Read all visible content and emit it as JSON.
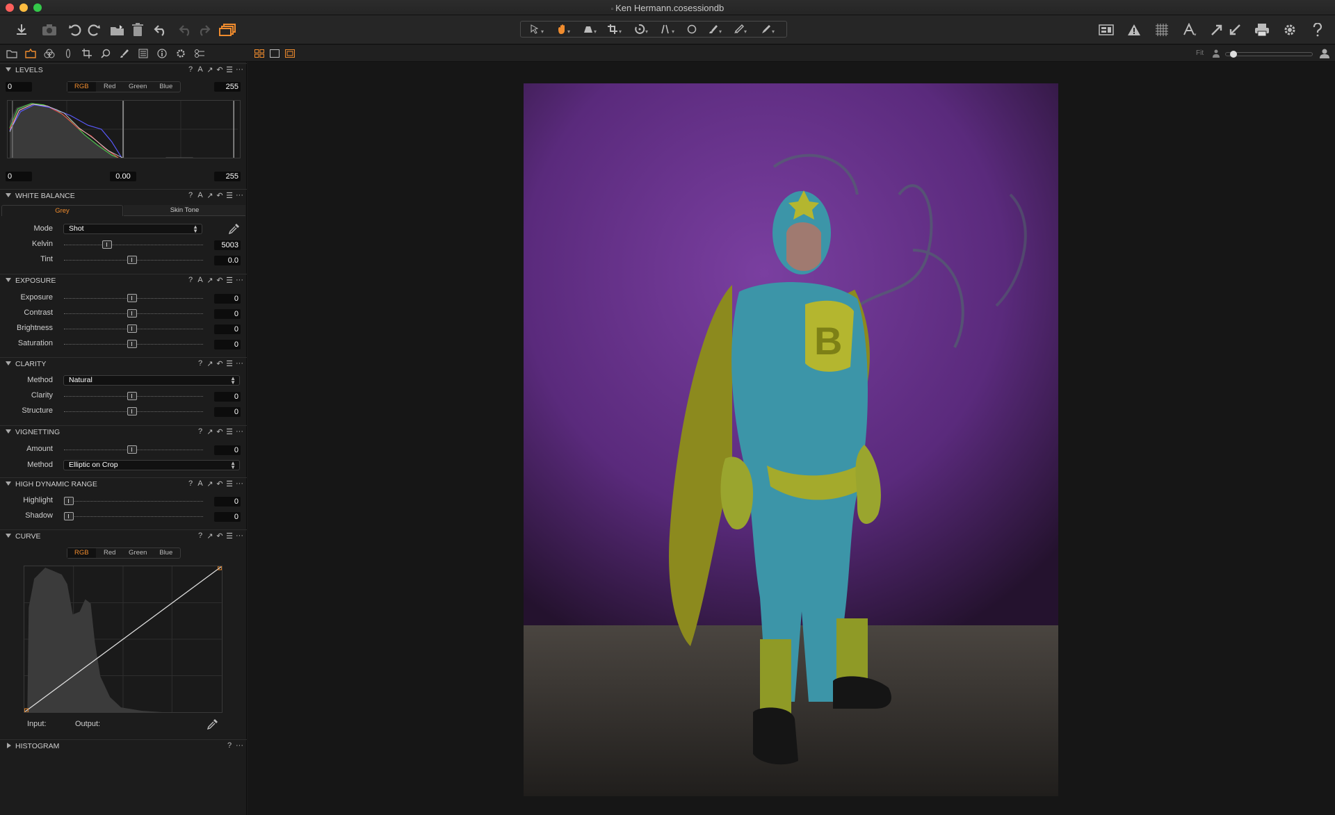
{
  "window": {
    "title": "Ken Hermann.cosessiondb"
  },
  "colors": {
    "accent": "#f08c2e",
    "red_curve": "#e04848",
    "green_curve": "#4ac44a",
    "blue_curve": "#5a5aff"
  },
  "toolbar": {
    "left_icons": [
      "import-icon",
      "camera-icon",
      "rotate-left-icon",
      "rotate-right-icon",
      "move-to-folder-icon",
      "trash-icon",
      "undo-icon",
      "undo-disabled-icon",
      "redo-disabled-icon",
      "copy-apply-icon"
    ],
    "cursor_tools": [
      "select-cursor-icon",
      "pan-hand-icon",
      "loupe-icon",
      "crop-icon",
      "rotate-straighten-icon",
      "keystone-icon",
      "spot-removal-icon",
      "brush-icon",
      "eraser-icon",
      "picker-icon"
    ],
    "right_icons": [
      "layout-icon",
      "exposure-warning-icon",
      "grid-icon",
      "text-overlay-icon",
      "copy-adjustments-icon",
      "apply-adjustments-icon",
      "print-icon",
      "settings-icon",
      "help-icon"
    ]
  },
  "viewer_bar": {
    "fit_label": "Fit"
  },
  "levels": {
    "name": "LEVELS",
    "input_low": "0",
    "input_high": "255",
    "output_low": "0",
    "midtone": "0.00",
    "output_high": "255",
    "channels": [
      "RGB",
      "Red",
      "Green",
      "Blue"
    ],
    "active_channel": "RGB"
  },
  "white_balance": {
    "name": "WHITE BALANCE",
    "tabs": [
      "Grey",
      "Skin Tone"
    ],
    "active_tab": "Grey",
    "mode_label": "Mode",
    "mode_value": "Shot",
    "kelvin_label": "Kelvin",
    "kelvin_value": "5003",
    "tint_label": "Tint",
    "tint_value": "0.0"
  },
  "exposure": {
    "name": "EXPOSURE",
    "rows": [
      {
        "label": "Exposure",
        "value": "0"
      },
      {
        "label": "Contrast",
        "value": "0"
      },
      {
        "label": "Brightness",
        "value": "0"
      },
      {
        "label": "Saturation",
        "value": "0"
      }
    ]
  },
  "clarity": {
    "name": "CLARITY",
    "method_label": "Method",
    "method_value": "Natural",
    "rows": [
      {
        "label": "Clarity",
        "value": "0"
      },
      {
        "label": "Structure",
        "value": "0"
      }
    ]
  },
  "vignetting": {
    "name": "VIGNETTING",
    "amount_label": "Amount",
    "amount_value": "0",
    "method_label": "Method",
    "method_value": "Elliptic on Crop"
  },
  "hdr": {
    "name": "HIGH DYNAMIC RANGE",
    "rows": [
      {
        "label": "Highlight",
        "value": "0"
      },
      {
        "label": "Shadow",
        "value": "0"
      }
    ]
  },
  "curve": {
    "name": "CURVE",
    "channels": [
      "RGB",
      "Red",
      "Green",
      "Blue"
    ],
    "active_channel": "RGB",
    "input_label": "Input:",
    "output_label": "Output:"
  },
  "histogram": {
    "name": "HISTOGRAM"
  }
}
